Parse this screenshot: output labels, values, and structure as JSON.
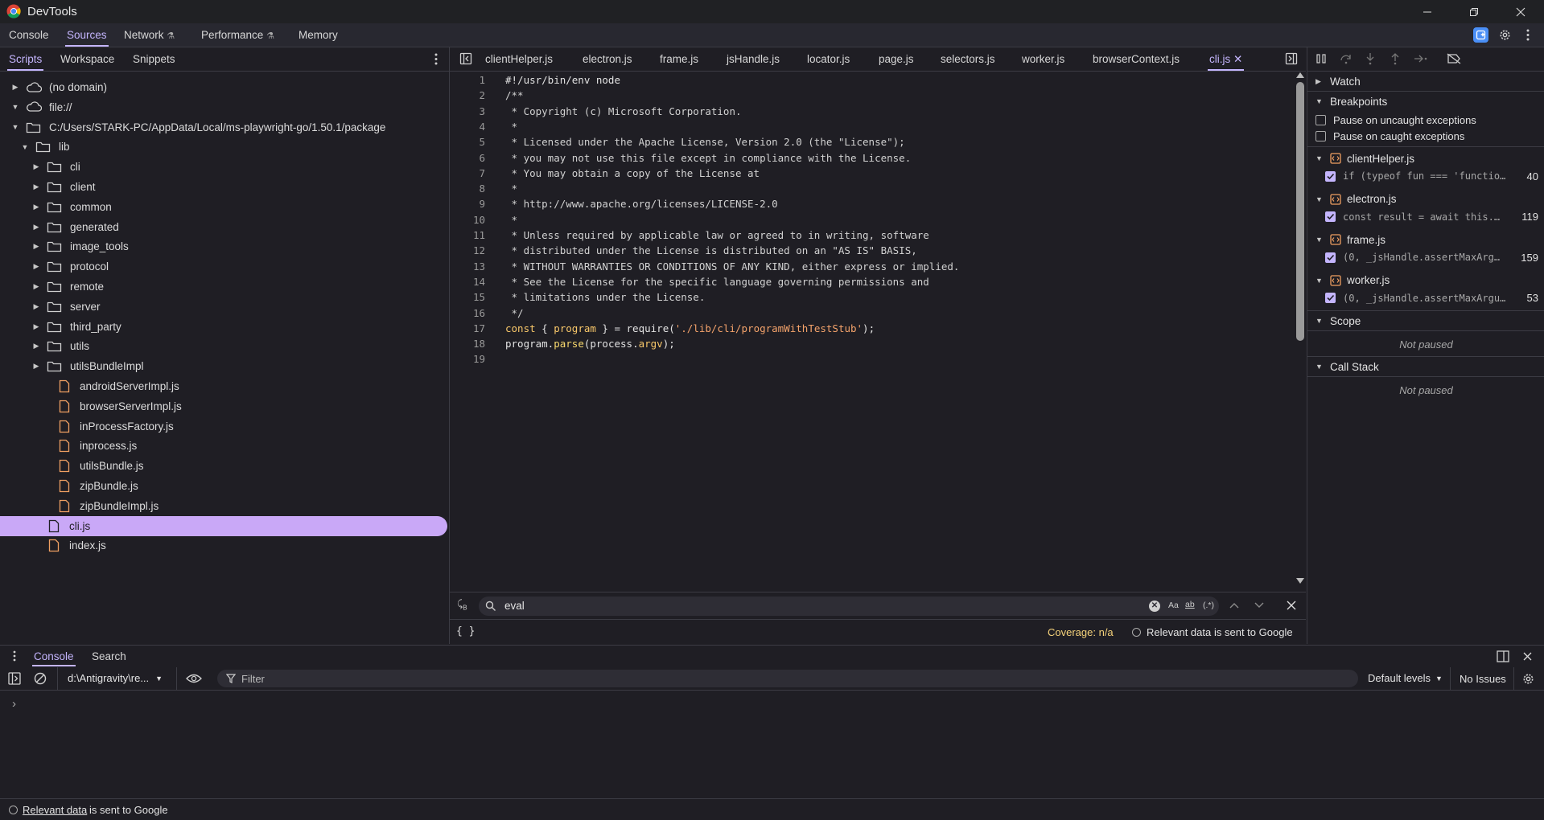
{
  "window": {
    "title": "DevTools",
    "minimize": "minimize-icon",
    "restore": "restore-icon",
    "close": "close-icon"
  },
  "main_tabs": [
    "Console",
    "Sources",
    "Network",
    "Performance",
    "Memory"
  ],
  "main_tab_active": "Sources",
  "navigator": {
    "tabs": [
      "Scripts",
      "Workspace",
      "Snippets"
    ],
    "active": "Scripts",
    "tree": [
      {
        "label": "(no domain)",
        "kind": "cloud",
        "depth": 0,
        "state": "collapsed"
      },
      {
        "label": "file://",
        "kind": "cloud",
        "depth": 0,
        "state": "expanded"
      },
      {
        "label": "C:/Users/STARK-PC/AppData/Local/ms-playwright-go/1.50.1/package",
        "kind": "folder",
        "depth": 1,
        "state": "expanded"
      },
      {
        "label": "lib",
        "kind": "folder",
        "depth": 2,
        "state": "expanded"
      },
      {
        "label": "cli",
        "kind": "folder",
        "depth": 3,
        "state": "collapsed"
      },
      {
        "label": "client",
        "kind": "folder",
        "depth": 3,
        "state": "collapsed"
      },
      {
        "label": "common",
        "kind": "folder",
        "depth": 3,
        "state": "collapsed"
      },
      {
        "label": "generated",
        "kind": "folder",
        "depth": 3,
        "state": "collapsed"
      },
      {
        "label": "image_tools",
        "kind": "folder",
        "depth": 3,
        "state": "collapsed"
      },
      {
        "label": "protocol",
        "kind": "folder",
        "depth": 3,
        "state": "collapsed"
      },
      {
        "label": "remote",
        "kind": "folder",
        "depth": 3,
        "state": "collapsed"
      },
      {
        "label": "server",
        "kind": "folder",
        "depth": 3,
        "state": "collapsed"
      },
      {
        "label": "third_party",
        "kind": "folder",
        "depth": 3,
        "state": "collapsed"
      },
      {
        "label": "utils",
        "kind": "folder",
        "depth": 3,
        "state": "collapsed"
      },
      {
        "label": "utilsBundleImpl",
        "kind": "folder",
        "depth": 3,
        "state": "collapsed"
      },
      {
        "label": "androidServerImpl.js",
        "kind": "file",
        "depth": 3
      },
      {
        "label": "browserServerImpl.js",
        "kind": "file",
        "depth": 3
      },
      {
        "label": "inProcessFactory.js",
        "kind": "file",
        "depth": 3
      },
      {
        "label": "inprocess.js",
        "kind": "file",
        "depth": 3
      },
      {
        "label": "utilsBundle.js",
        "kind": "file",
        "depth": 3
      },
      {
        "label": "zipBundle.js",
        "kind": "file",
        "depth": 3
      },
      {
        "label": "zipBundleImpl.js",
        "kind": "file",
        "depth": 3
      },
      {
        "label": "cli.js",
        "kind": "file",
        "depth": 2,
        "selected": true
      },
      {
        "label": "index.js",
        "kind": "file",
        "depth": 2
      }
    ]
  },
  "editor": {
    "tabs": [
      "clientHelper.js",
      "electron.js",
      "frame.js",
      "jsHandle.js",
      "locator.js",
      "page.js",
      "selectors.js",
      "worker.js",
      "browserContext.js",
      "cli.js"
    ],
    "active": "cli.js",
    "lines": [
      "#!/usr/bin/env node",
      "/**",
      " * Copyright (c) Microsoft Corporation.",
      " *",
      " * Licensed under the Apache License, Version 2.0 (the \"License\");",
      " * you may not use this file except in compliance with the License.",
      " * You may obtain a copy of the License at",
      " *",
      " * http://www.apache.org/licenses/LICENSE-2.0",
      " *",
      " * Unless required by applicable law or agreed to in writing, software",
      " * distributed under the License is distributed on an \"AS IS\" BASIS,",
      " * WITHOUT WARRANTIES OR CONDITIONS OF ANY KIND, either express or implied.",
      " * See the License for the specific language governing permissions and",
      " * limitations under the License.",
      " */",
      "",
      "",
      ""
    ],
    "line17": {
      "kw": "const",
      "p1": " { ",
      "var": "program",
      "p2": " } = require(",
      "str": "'./lib/cli/programWithTestStub'",
      "p3": ");"
    },
    "line18": {
      "p1": "program.",
      "fn": "parse",
      "p2": "(process.",
      "var": "argv",
      "p3": ");"
    },
    "search": {
      "value": "eval",
      "match_case": "Aa",
      "whole_word": "ab",
      "regex": "(.*)"
    },
    "status": {
      "coverage": "Coverage: n/a",
      "relevant_link": "Relevant data",
      "relevant_rest": " is sent to Google",
      "pretty_print": "{ }"
    }
  },
  "debugger": {
    "sections": {
      "watch": "Watch",
      "breakpoints": "Breakpoints",
      "scope": "Scope",
      "call_stack": "Call Stack"
    },
    "pause_uncaught": "Pause on uncaught exceptions",
    "pause_caught": "Pause on caught exceptions",
    "breakpoints": [
      {
        "file": "clientHelper.js",
        "code": "if (typeof fun === 'functio…",
        "line": "40"
      },
      {
        "file": "electron.js",
        "code": "const result = await this.…",
        "line": "119"
      },
      {
        "file": "frame.js",
        "code": "(0, _jsHandle.assertMaxArg…",
        "line": "159"
      },
      {
        "file": "worker.js",
        "code": "(0, _jsHandle.assertMaxArgu…",
        "line": "53"
      }
    ],
    "not_paused": "Not paused"
  },
  "drawer": {
    "tabs": [
      "Console",
      "Search"
    ],
    "active": "Console",
    "context": "d:\\Antigravity\\re...",
    "filter_placeholder": "Filter",
    "levels": "Default levels",
    "issues": "No Issues",
    "prompt": "›",
    "footer_link": "Relevant data",
    "footer_rest": " is sent to Google"
  },
  "colors": {
    "accent": "#c4b5fd",
    "selection": "#c9a8f7",
    "file_icon": "#f0a062",
    "bg": "#1f1e24"
  }
}
